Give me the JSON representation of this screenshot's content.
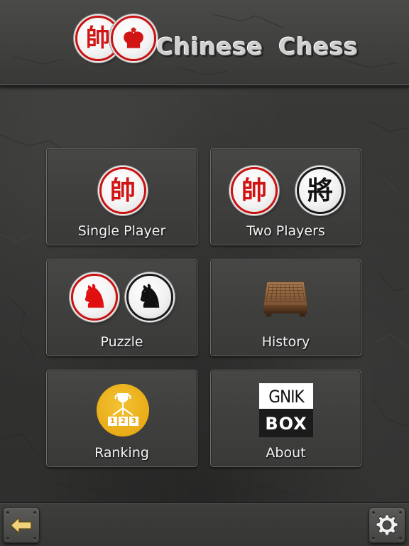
{
  "header": {
    "title": "Chinese  Chess",
    "logo_pieces": [
      {
        "glyph": "帥",
        "color": "red",
        "icon": "shuai-piece-icon"
      },
      {
        "glyph": "♚",
        "color": "red",
        "icon": "king-piece-icon"
      }
    ]
  },
  "menu": {
    "single_player": {
      "label": "Single Player",
      "piece_glyph": "帥"
    },
    "two_players": {
      "label": "Two Players",
      "red_glyph": "帥",
      "black_glyph": "將"
    },
    "puzzle": {
      "label": "Puzzle",
      "red_glyph": "♞",
      "black_glyph": "♞"
    },
    "history": {
      "label": "History",
      "icon": "board-icon"
    },
    "ranking": {
      "label": "Ranking",
      "icon": "trophy-podium-icon",
      "podium_numbers": [
        "1",
        "2",
        "3"
      ]
    },
    "about": {
      "label": "About",
      "logo_top": "GNIK",
      "logo_bottom": "BOX"
    }
  },
  "footer": {
    "back_icon": "back-arrow-icon",
    "settings_icon": "gear-icon"
  },
  "colors": {
    "red_piece": "#d11414",
    "black_piece": "#111111",
    "background": "#353534",
    "tile_border": "#6e6e6c",
    "badge_gold": "#e8ac16"
  }
}
